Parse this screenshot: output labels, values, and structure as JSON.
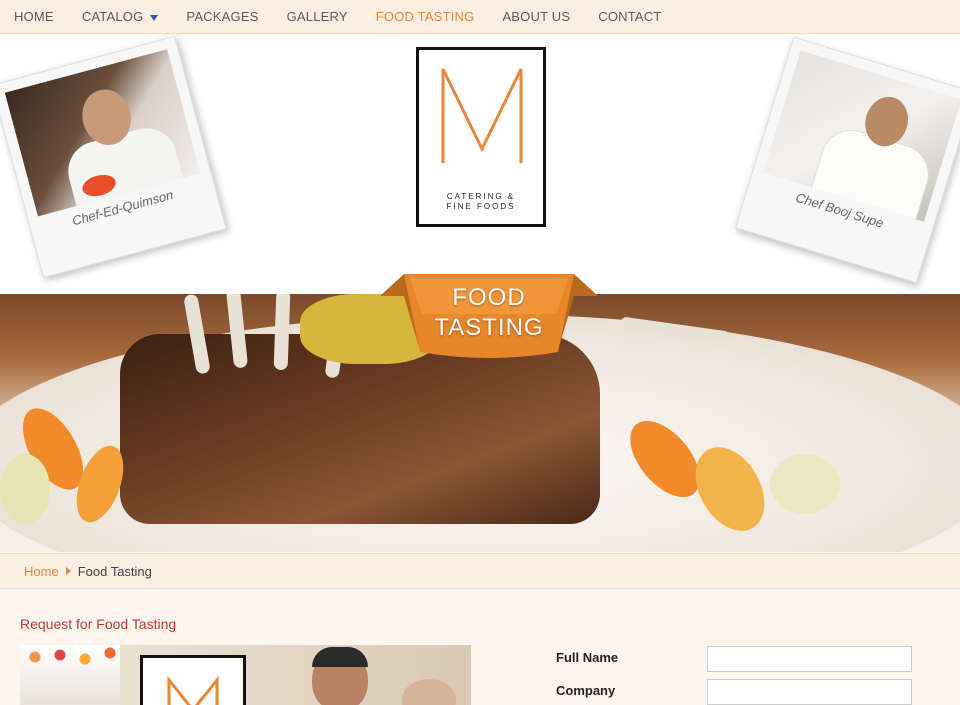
{
  "nav": {
    "items": [
      {
        "label": "HOME"
      },
      {
        "label": "CATALOG"
      },
      {
        "label": "PACKAGES"
      },
      {
        "label": "GALLERY"
      },
      {
        "label": "FOOD TASTING"
      },
      {
        "label": "ABOUT US"
      },
      {
        "label": "CONTACT"
      }
    ],
    "active": "FOOD TASTING"
  },
  "header": {
    "chef_left_caption": "Chef-Ed-Quimson",
    "chef_right_caption": "Chef Booj Supe",
    "logo_line1": "CATERING &",
    "logo_line2": "FINE FOODS"
  },
  "hero": {
    "ribbon_line1": "FOOD",
    "ribbon_line2": "TASTING"
  },
  "breadcrumb": {
    "home": "Home",
    "current": "Food Tasting"
  },
  "form": {
    "section_title": "Request for Food Tasting",
    "full_name_label": "Full Name",
    "full_name_value": "",
    "company_label": "Company",
    "company_value": ""
  },
  "colors": {
    "accent": "#e8863a",
    "nav_bg": "#fbeee3",
    "title_red": "#c0392b"
  }
}
